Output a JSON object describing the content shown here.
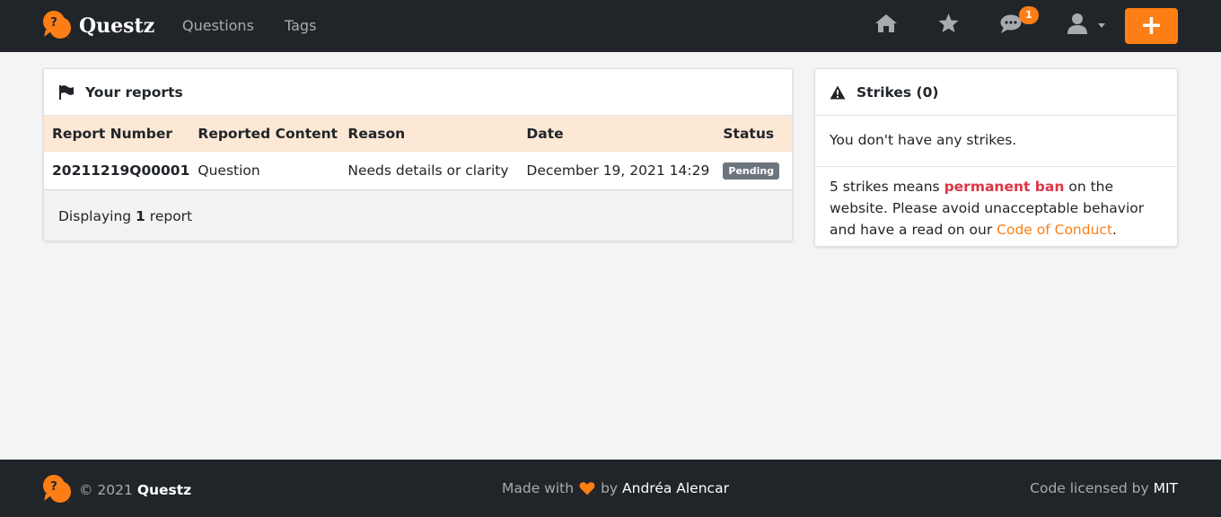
{
  "nav": {
    "brand": "Questz",
    "links": [
      "Questions",
      "Tags"
    ],
    "notifications_count": "1",
    "add_label": "+"
  },
  "reports": {
    "title": "Your reports",
    "columns": [
      "Report Number",
      "Reported Content",
      "Reason",
      "Date",
      "Status"
    ],
    "rows": [
      {
        "number": "20211219Q00001",
        "content": "Question",
        "reason": "Needs details or clarity",
        "date": "December 19, 2021 14:29",
        "status": "Pending"
      }
    ],
    "footer_prefix": "Displaying",
    "footer_count": "1",
    "footer_suffix": "report"
  },
  "strikes": {
    "title": "Strikes (0)",
    "empty_text": "You don't have any strikes.",
    "info_prefix": "5 strikes means",
    "info_ban": "permanent ban",
    "info_mid": "on the website. Please avoid unacceptable behavior and have a read on our",
    "info_link": "Code of Conduct",
    "info_suffix": "."
  },
  "footer": {
    "copyright": "© 2021",
    "brand": "Questz",
    "made_with": "Made with",
    "by": "by",
    "author": "Andréa Alencar",
    "license_prefix": "Code licensed by",
    "license": "MIT"
  },
  "colors": {
    "accent": "#fd7e14",
    "navbar": "#212529",
    "danger": "#dc3545",
    "table_header": "#fde8d6"
  }
}
